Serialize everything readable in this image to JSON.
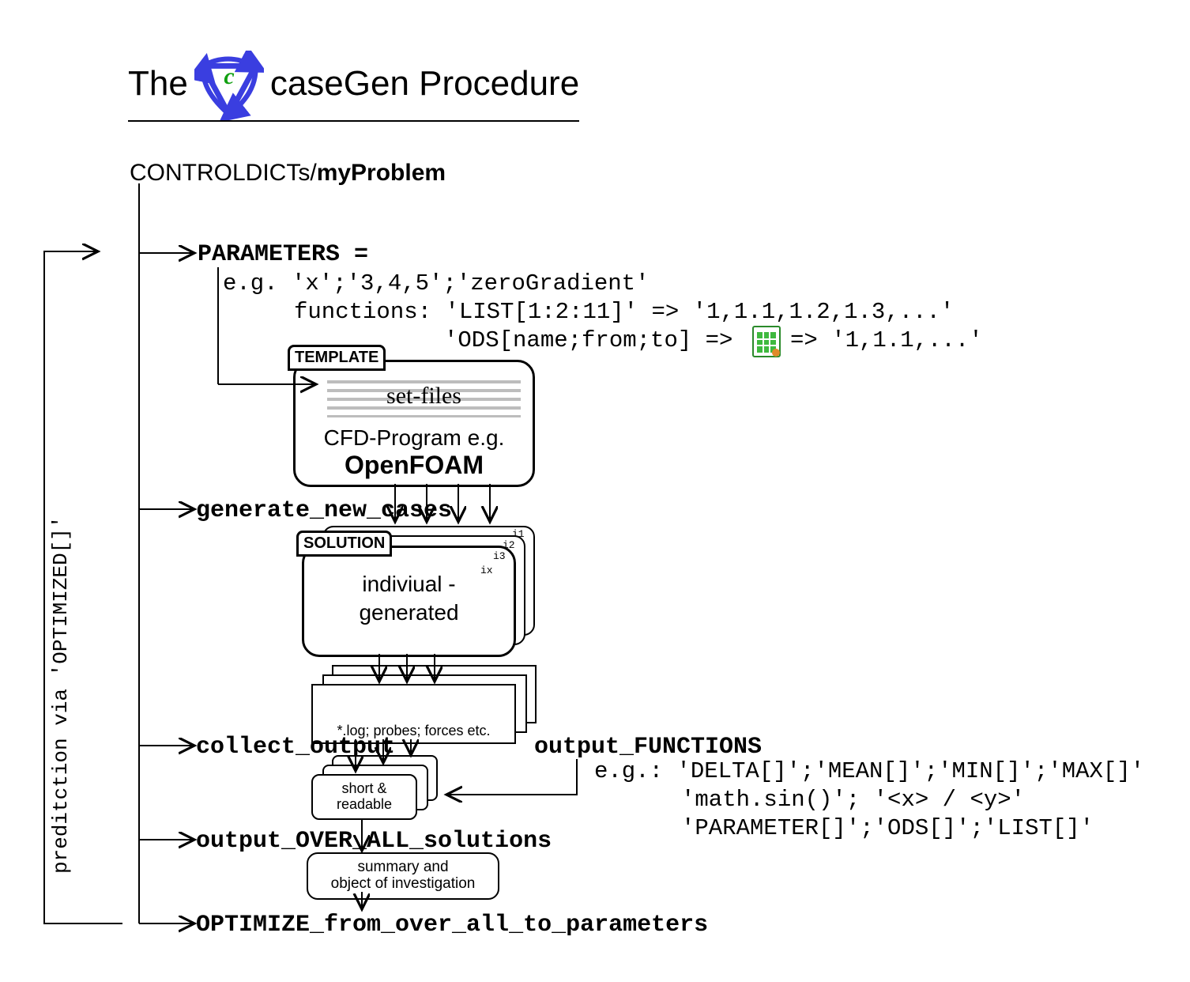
{
  "title_left": "The",
  "title_right": "caseGen Procedure",
  "controldicts_prefix": "CONTROLDICTs/",
  "controldicts_name": "myProblem",
  "parameters_label": "PARAMETERS =",
  "parameters_example": "e.g. 'x';'3,4,5';'zeroGradient'",
  "parameters_func_line": "functions: 'LIST[1:2:11]' => '1,1.1,1.2,1.3,...'",
  "parameters_ods_left": "'ODS[name;from;to] =>",
  "parameters_ods_right": "=> '1,1.1,...'",
  "template_tab": "TEMPLATE",
  "template_setfiles": "set-files",
  "template_cfd_prefix": "CFD-Program e.g.",
  "template_cfd_name": "OpenFOAM",
  "generate_label": "generate_new_cases",
  "solution_tab": "SOLUTION",
  "solution_text1": "indiviual -",
  "solution_text2": "generated",
  "solution_i1": "i1",
  "solution_i2": "i2",
  "solution_i3": "i3",
  "solution_ix": "ix",
  "log_text": "*.log; probes; forces etc.",
  "collect_label": "collect_output",
  "output_functions_label": "output_FUNCTIONS",
  "output_functions_eg": "e.g.:",
  "output_functions_l1": "'DELTA[]';'MEAN[]';'MIN[]';'MAX[]'",
  "output_functions_l2": "'math.sin()'; '<x> / <y>'",
  "output_functions_l3": "'PARAMETER[]';'ODS[]';'LIST[]'",
  "short1": "short &",
  "short2": "readable",
  "overall_label": "output_OVER_ALL_solutions",
  "summary1": "summary and",
  "summary2": "object of investigation",
  "optimize_label": "OPTIMIZE_from_over_all_to_parameters",
  "vert_text": "preditction via 'OPTIMIZED[]'"
}
